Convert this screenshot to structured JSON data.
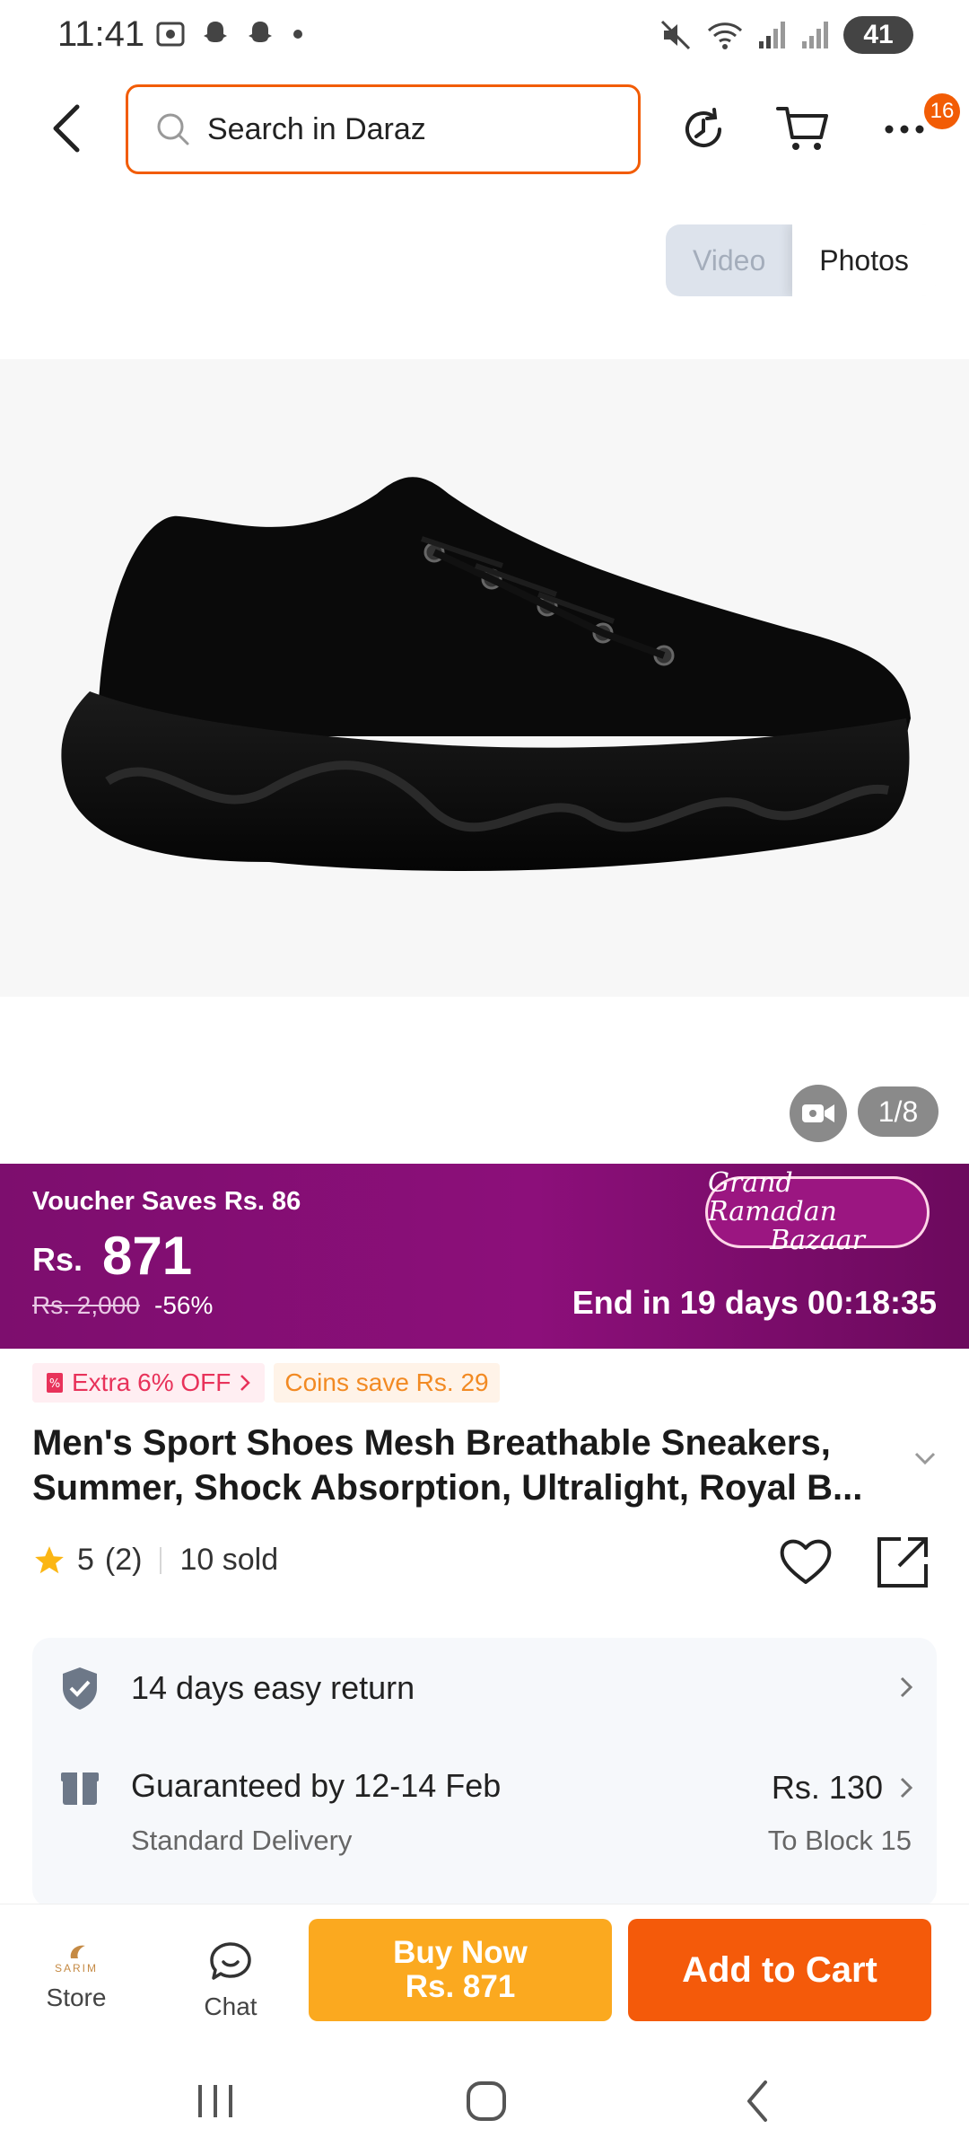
{
  "status_bar": {
    "time": "11:41",
    "battery": "41",
    "icons": [
      "screenshot-icon",
      "snapchat-icon",
      "snapchat-icon",
      "dot-icon",
      "mute-icon",
      "wifi-icon",
      "signal-icon",
      "signal-icon"
    ]
  },
  "header": {
    "search_placeholder": "Search in Daraz",
    "cart_badge": "16",
    "icons": [
      "back-icon",
      "search-icon",
      "history-icon",
      "cart-icon",
      "more-icon"
    ]
  },
  "media": {
    "video_label": "Video",
    "photos_label": "Photos",
    "image_counter": "1/8"
  },
  "promo": {
    "voucher": "Voucher Saves Rs. 86",
    "currency": "Rs.",
    "price": "871",
    "original_price": "Rs. 2,000",
    "discount": "-56%",
    "campaign_line1": "Grand Ramadan",
    "campaign_line2": "Bazaar",
    "countdown": "End in 19 days 00:18:35",
    "colors": {
      "banner": "#8c0f7a"
    }
  },
  "tags": {
    "extra_off": "Extra 6% OFF",
    "coins": "Coins save Rs. 29"
  },
  "product": {
    "title": "Men's Sport Shoes Mesh Breathable Sneakers, Summer, Shock Absorption, Ultralight, Royal B...",
    "rating": "5",
    "reviews": "(2)",
    "sold": "10 sold"
  },
  "service": {
    "return_label": "14 days easy return",
    "delivery_label": "Guaranteed by 12-14 Feb",
    "delivery_type": "Standard Delivery",
    "delivery_price": "Rs. 130",
    "delivery_destination": "To Block 15"
  },
  "actions": {
    "store_logo": "SARIM",
    "store_label": "Store",
    "chat_label": "Chat",
    "buy_now_label": "Buy Now",
    "buy_now_price": "Rs. 871",
    "add_to_cart_label": "Add to Cart",
    "colors": {
      "buy_now": "#fba91f",
      "add_to_cart": "#f45a0a",
      "accent": "#f25c05"
    }
  }
}
